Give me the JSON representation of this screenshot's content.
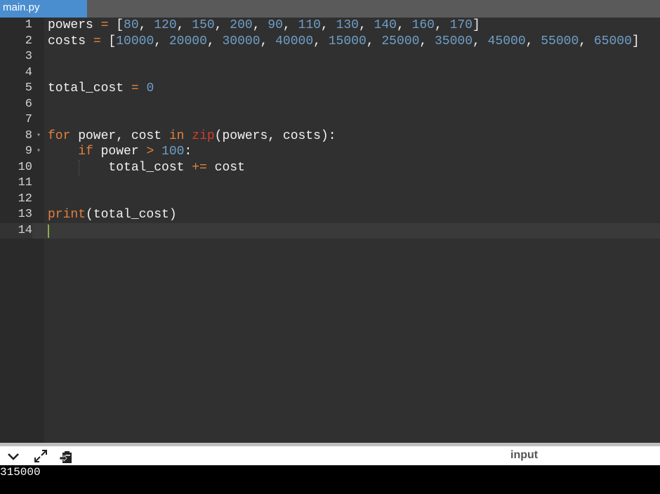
{
  "tab": {
    "filename": "main.py"
  },
  "editor": {
    "line_numbers": [
      "1",
      "2",
      "3",
      "4",
      "5",
      "6",
      "7",
      "8",
      "9",
      "10",
      "11",
      "12",
      "13",
      "14"
    ],
    "code": {
      "l1": {
        "name": "powers",
        "assign": " = ",
        "open": "[",
        "nums": [
          "80",
          "120",
          "150",
          "200",
          "90",
          "110",
          "130",
          "140",
          "160",
          "170"
        ],
        "close": "]"
      },
      "l2": {
        "name": "costs",
        "assign": " = ",
        "open": "[",
        "nums": [
          "10000",
          "20000",
          "30000",
          "40000",
          "15000",
          "25000",
          "35000",
          "45000",
          "55000",
          "65000"
        ],
        "close": "]"
      },
      "l5": {
        "name": "total_cost",
        "assign": " = ",
        "value": "0"
      },
      "l8": {
        "kw_for": "for",
        "vars": " power, cost ",
        "kw_in": "in",
        "sp": " ",
        "fn": "zip",
        "args": "(powers, costs):"
      },
      "l9": {
        "kw_if": "if",
        "cond": " power ",
        "op": ">",
        "sp": " ",
        "num": "100",
        "colon": ":"
      },
      "l10": {
        "lhs": "total_cost ",
        "op": "+=",
        "rhs": " cost"
      },
      "l13": {
        "fn": "print",
        "args": "(total_cost)"
      }
    },
    "colors": {
      "keyword": "#e2803d",
      "builtin": "#cf3d2d",
      "number": "#6f9fc8",
      "text": "#f2f2f2",
      "cursor": "#88b04b"
    }
  },
  "panel": {
    "input_label": "input",
    "icons": [
      "chevron-down-icon",
      "expand-icon",
      "paste-icon"
    ]
  },
  "console": {
    "output": "315000"
  }
}
